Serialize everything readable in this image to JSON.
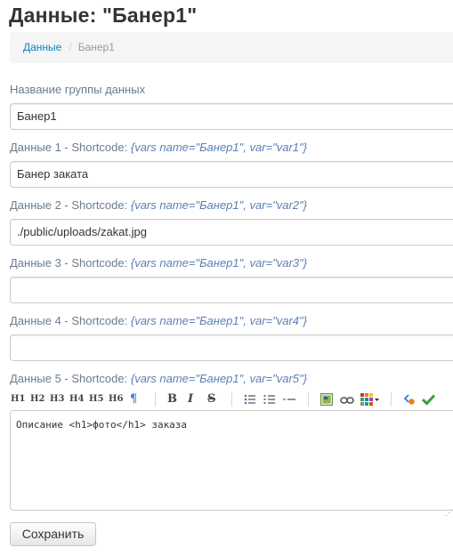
{
  "page": {
    "title": "Данные: \"Банер1\""
  },
  "breadcrumb": {
    "link": "Данные",
    "separator": "/",
    "current": "Банер1"
  },
  "group": {
    "label": "Название группы данных",
    "value": "Банер1"
  },
  "fields": [
    {
      "label": "Данные 1 - Shortcode: ",
      "shortcode": "{vars name=\"Банер1\", var=\"var1\"}",
      "value": "Банер заката"
    },
    {
      "label": "Данные 2 - Shortcode: ",
      "shortcode": "{vars name=\"Банер1\", var=\"var2\"}",
      "value": "./public/uploads/zakat.jpg"
    },
    {
      "label": "Данные 3 - Shortcode: ",
      "shortcode": "{vars name=\"Банер1\", var=\"var3\"}",
      "value": ""
    },
    {
      "label": "Данные 4 - Shortcode: ",
      "shortcode": "{vars name=\"Банер1\", var=\"var4\"}",
      "value": ""
    },
    {
      "label": "Данные 5 - Shortcode: ",
      "shortcode": "{vars name=\"Банер1\", var=\"var5\"}",
      "value": "Описание <h1>фото</h1> заказа"
    }
  ],
  "toolbar": {
    "h1": "H1",
    "h2": "H2",
    "h3": "H3",
    "h4": "H4",
    "h5": "H5",
    "h6": "H6",
    "paragraph": "¶",
    "bold": "B",
    "italic": "I",
    "strike": "S"
  },
  "colors": {
    "link": "#0088cc",
    "label": "#6a7c8f",
    "shortcode": "#5b7fb5",
    "breadcrumb_bg": "#f5f5f5"
  },
  "buttons": {
    "save": "Сохранить"
  }
}
